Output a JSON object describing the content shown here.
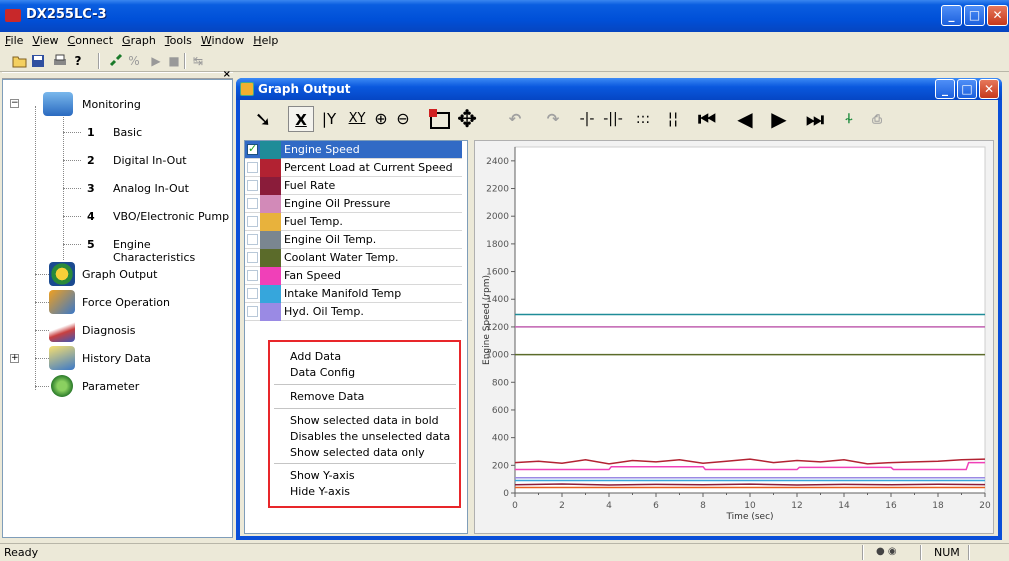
{
  "app": {
    "title": "DX255LC-3"
  },
  "menu": [
    "File",
    "View",
    "Connect",
    "Graph",
    "Tools",
    "Window",
    "Help"
  ],
  "sidebar": {
    "root": "Monitoring",
    "monitoring_items": [
      {
        "num": "1",
        "label": "Basic"
      },
      {
        "num": "2",
        "label": "Digital In-Out"
      },
      {
        "num": "3",
        "label": "Analog In-Out"
      },
      {
        "num": "4",
        "label": "VBO/Electronic Pump"
      },
      {
        "num": "5",
        "label": "Engine Characteristics"
      }
    ],
    "items": [
      "Graph Output",
      "Force Operation",
      "Diagnosis",
      "History Data",
      "Parameter"
    ]
  },
  "graph_window": {
    "title": "Graph Output",
    "toolbar": [
      "pointer",
      "X",
      "Y",
      "XY",
      "zoom-in",
      "zoom-out",
      "select-range",
      "move",
      "undo",
      "redo",
      "cursor-1",
      "cursor-2",
      "cursor-grid",
      "cursor-vertical",
      "first",
      "previous",
      "next",
      "last",
      "auto-scale",
      "print"
    ]
  },
  "data_list": [
    {
      "label": "Engine Speed",
      "color": "#1f8c98",
      "checked": true,
      "selected": true
    },
    {
      "label": "Percent Load at Current Speed",
      "color": "#b22232",
      "checked": false
    },
    {
      "label": "Fuel Rate",
      "color": "#8a1c3a",
      "checked": false
    },
    {
      "label": "Engine Oil Pressure",
      "color": "#d28ab8",
      "checked": false
    },
    {
      "label": "Fuel Temp.",
      "color": "#e8b23c",
      "checked": false
    },
    {
      "label": "Engine Oil Temp.",
      "color": "#7a8690",
      "checked": false
    },
    {
      "label": "Coolant Water Temp.",
      "color": "#5b6b2a",
      "checked": false
    },
    {
      "label": "Fan Speed",
      "color": "#f040b8",
      "checked": false
    },
    {
      "label": "Intake Manifold Temp",
      "color": "#36a6dc",
      "checked": false
    },
    {
      "label": "Hyd. Oil Temp.",
      "color": "#9a8ae4",
      "checked": false
    }
  ],
  "context_menu": {
    "groups": [
      [
        "Add Data",
        "Data Config"
      ],
      [
        "Remove Data"
      ],
      [
        "Show selected data in bold",
        "Disables the unselected data",
        "Show selected data only"
      ],
      [
        "Show Y-axis",
        "Hide Y-axis"
      ]
    ]
  },
  "chart_data": {
    "type": "line",
    "xlabel": "Time (sec)",
    "ylabel": "Engine Speed (rpm)",
    "xlim": [
      0,
      20
    ],
    "ylim": [
      0,
      2500
    ],
    "x_ticks": [
      0,
      2,
      4,
      6,
      8,
      10,
      12,
      14,
      16,
      18,
      20
    ],
    "y_ticks": [
      0,
      200,
      400,
      600,
      800,
      1000,
      1200,
      1400,
      1600,
      1800,
      2000,
      2200,
      2400
    ],
    "series": [
      {
        "color": "#1f8c98",
        "x": [
          0,
          20
        ],
        "y": [
          1290,
          1290
        ]
      },
      {
        "color": "#c060b0",
        "x": [
          0,
          20
        ],
        "y": [
          1200,
          1200
        ]
      },
      {
        "color": "#5b6b2a",
        "x": [
          0,
          20
        ],
        "y": [
          1000,
          1000
        ]
      },
      {
        "color": "#b22232",
        "x": [
          0,
          1,
          2,
          3,
          4,
          5,
          6,
          7,
          8,
          9,
          10,
          11,
          12,
          13,
          14,
          15,
          16,
          17,
          18,
          19,
          20
        ],
        "y": [
          220,
          230,
          215,
          240,
          210,
          235,
          225,
          240,
          215,
          230,
          245,
          220,
          235,
          225,
          240,
          210,
          220,
          225,
          230,
          240,
          245
        ]
      },
      {
        "color": "#f040b8",
        "x": [
          0,
          4,
          4.1,
          8,
          8.1,
          12,
          12.1,
          16,
          16.1,
          19.2,
          19.3,
          20
        ],
        "y": [
          170,
          170,
          190,
          190,
          170,
          170,
          185,
          185,
          170,
          170,
          220,
          220
        ]
      },
      {
        "color": "#36a6dc",
        "x": [
          0,
          20
        ],
        "y": [
          90,
          90
        ]
      },
      {
        "color": "#9a8ae4",
        "x": [
          0,
          20
        ],
        "y": [
          110,
          110
        ]
      },
      {
        "color": "#8a1c3a",
        "x": [
          0,
          2,
          4,
          6,
          8,
          10,
          12,
          14,
          16,
          18,
          20
        ],
        "y": [
          60,
          65,
          58,
          62,
          60,
          64,
          58,
          62,
          60,
          63,
          61
        ]
      },
      {
        "color": "#e86020",
        "x": [
          0,
          20
        ],
        "y": [
          40,
          40
        ]
      }
    ]
  },
  "status": {
    "text": "Ready",
    "num": "NUM"
  }
}
